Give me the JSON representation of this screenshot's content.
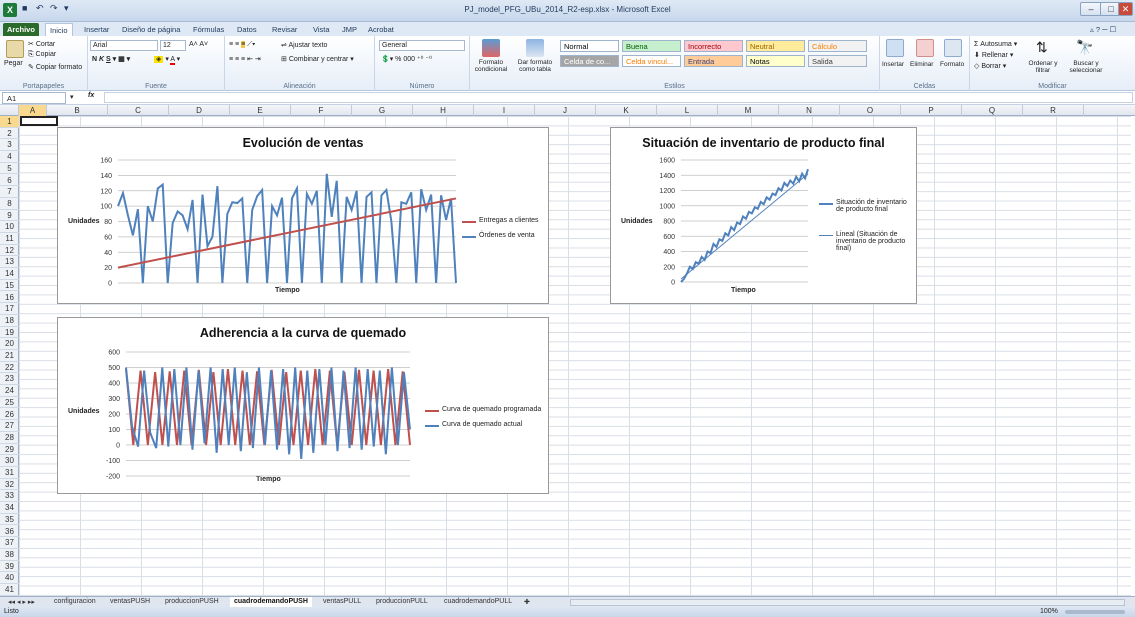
{
  "window": {
    "title": "PJ_model_PFG_UBu_2014_R2-esp.xlsx - Microsoft Excel"
  },
  "tabs": [
    "Archivo",
    "Inicio",
    "Insertar",
    "Diseño de página",
    "Fórmulas",
    "Datos",
    "Revisar",
    "Vista",
    "JMP",
    "Acrobat"
  ],
  "ribbon": {
    "clipboard": {
      "cut": "Cortar",
      "copy": "Copiar",
      "paste": "Pegar",
      "format_painter": "Copiar formato",
      "label": "Portapapeles"
    },
    "font": {
      "family": "Arial",
      "size": "12",
      "label": "Fuente"
    },
    "alignment": {
      "wrap": "Ajustar texto",
      "merge": "Combinar y centrar",
      "label": "Alineación"
    },
    "number": {
      "format": "General",
      "label": "Número"
    },
    "styles": {
      "conditional": "Formato condicional",
      "table": "Dar formato como tabla",
      "label": "Estilos",
      "cells": [
        {
          "text": "Normal",
          "bg": "#ffffff",
          "fg": "#000000"
        },
        {
          "text": "Buena",
          "bg": "#c6efce",
          "fg": "#006100"
        },
        {
          "text": "Incorrecto",
          "bg": "#ffc7ce",
          "fg": "#9c0006"
        },
        {
          "text": "Neutral",
          "bg": "#ffeb9c",
          "fg": "#9c6500"
        },
        {
          "text": "Cálculo",
          "bg": "#f2f2f2",
          "fg": "#fa7d00"
        },
        {
          "text": "Celda de co...",
          "bg": "#a5a5a5",
          "fg": "#ffffff"
        },
        {
          "text": "Celda vincul...",
          "bg": "#ffffff",
          "fg": "#fa7d00"
        },
        {
          "text": "Entrada",
          "bg": "#ffcc99",
          "fg": "#3f3f76"
        },
        {
          "text": "Notas",
          "bg": "#ffffcc",
          "fg": "#000000"
        },
        {
          "text": "Salida",
          "bg": "#f2f2f2",
          "fg": "#3f3f3f"
        }
      ]
    },
    "cells": {
      "insert": "Insertar",
      "delete": "Eliminar",
      "format": "Formato",
      "label": "Celdas"
    },
    "modify": {
      "autosum": "Autosuma",
      "fill": "Rellenar",
      "clear": "Borrar",
      "sort": "Ordenar y filtrar",
      "find": "Buscar y seleccionar",
      "label": "Modificar"
    }
  },
  "formula_bar": {
    "name_box": "A1",
    "fx": "fx",
    "value": ""
  },
  "columns": [
    "A",
    "B",
    "C",
    "D",
    "E",
    "F",
    "G",
    "H",
    "I",
    "J",
    "K",
    "L",
    "M",
    "N",
    "O",
    "P",
    "Q",
    "R"
  ],
  "rows": [
    "1",
    "2",
    "3",
    "4",
    "5",
    "6",
    "7",
    "8",
    "9",
    "10",
    "11",
    "12",
    "13",
    "14",
    "15",
    "16",
    "17",
    "18",
    "19",
    "20",
    "21",
    "22",
    "23",
    "24",
    "25",
    "26",
    "27",
    "28",
    "29",
    "30",
    "31",
    "32",
    "33",
    "34",
    "35",
    "36",
    "37",
    "38",
    "39",
    "40",
    "41"
  ],
  "sheets": [
    "configuracion",
    "ventasPUSH",
    "produccionPUSH",
    "cuadrodemandoPUSH",
    "ventasPULL",
    "produccionPULL",
    "cuadrodemandoPULL"
  ],
  "status": {
    "ready": "Listo",
    "zoom": "100%"
  },
  "chart_data": [
    {
      "type": "line",
      "title": "Evolución de ventas",
      "xlabel": "Tiempo",
      "ylabel": "Unidades",
      "ylim": [
        0,
        160
      ],
      "yticks": [
        0,
        20,
        40,
        60,
        80,
        100,
        120,
        140,
        160
      ],
      "series": [
        {
          "name": "Entregas a clientes",
          "color": "#c0504d",
          "values": [
            20,
            110
          ]
        },
        {
          "name": "Órdenes de venta",
          "color": "#4f81bd",
          "values": [
            100,
            117,
            88,
            62,
            96,
            0,
            100,
            80,
            123,
            128,
            0,
            78,
            93,
            88,
            70,
            108,
            0,
            115,
            48,
            60,
            126,
            0,
            90,
            105,
            104,
            110,
            0,
            95,
            113,
            121,
            0,
            100,
            88,
            111,
            0,
            110,
            123,
            0,
            116,
            103,
            120,
            0,
            142,
            86,
            133,
            0,
            112,
            95,
            120,
            0,
            112,
            118,
            0,
            114,
            121,
            80,
            0,
            105,
            103,
            118,
            0,
            122,
            95,
            115,
            0,
            114,
            82,
            110,
            0
          ]
        }
      ]
    },
    {
      "type": "line",
      "title": "Situación de inventario de producto final",
      "xlabel": "Tiempo",
      "ylabel": "Unidades",
      "ylim": [
        0,
        1600
      ],
      "yticks": [
        0,
        200,
        400,
        600,
        800,
        1000,
        1200,
        1400,
        1600
      ],
      "series": [
        {
          "name": "Situación de inventario de producto final",
          "color": "#4f81bd",
          "values": [
            0,
            40,
            110,
            200,
            170,
            260,
            240,
            330,
            290,
            400,
            380,
            500,
            460,
            560,
            540,
            640,
            610,
            720,
            680,
            780,
            760,
            860,
            830,
            920,
            900,
            980,
            960,
            1050,
            1020,
            1110,
            1080,
            1160,
            1140,
            1230,
            1200,
            1300,
            1260,
            1330,
            1290,
            1380,
            1320,
            1420,
            1360,
            1480
          ]
        },
        {
          "name": "Lineal (Situación de inventario de producto final)",
          "color": "#4f81bd",
          "values": [
            40,
            1420
          ]
        }
      ]
    },
    {
      "type": "line",
      "title": "Adherencia a la curva de quemado",
      "xlabel": "Tiempo",
      "ylabel": "Unidades",
      "ylim": [
        -200,
        600
      ],
      "yticks": [
        -200,
        -100,
        0,
        100,
        200,
        300,
        400,
        500,
        600
      ],
      "series": [
        {
          "name": "Curva de quemado programada",
          "color": "#c0504d",
          "values": [
            490,
            0,
            480,
            0,
            470,
            0,
            475,
            0,
            480,
            0,
            485,
            0,
            470,
            0,
            490,
            0,
            480,
            0,
            475,
            0,
            485,
            0,
            470,
            0,
            480,
            0,
            490,
            0,
            480,
            0,
            470,
            0,
            485,
            0,
            480,
            0,
            490,
            0,
            475,
            0
          ]
        },
        {
          "name": "Curva de quemado actual",
          "color": "#4f81bd",
          "values": [
            500,
            120,
            -10,
            480,
            80,
            -20,
            500,
            -10,
            490,
            0,
            500,
            -30,
            480,
            10,
            500,
            -50,
            490,
            0,
            500,
            -40,
            470,
            -20,
            500,
            0,
            480,
            -30,
            490,
            -60,
            500,
            -90,
            480,
            -50,
            490,
            0,
            500,
            -40,
            480,
            -20,
            500,
            -30,
            490,
            -10,
            480,
            -60,
            500,
            0,
            470,
            100
          ]
        }
      ]
    }
  ]
}
